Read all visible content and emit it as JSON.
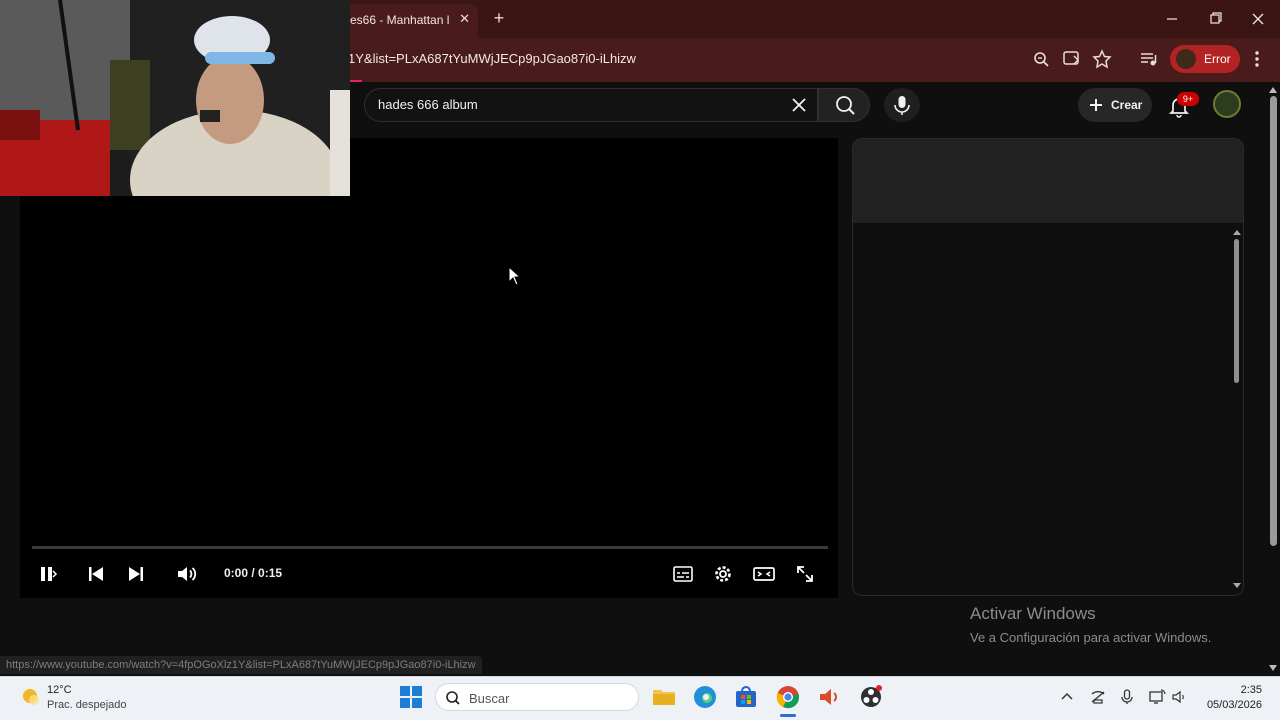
{
  "browser": {
    "tab_title": "es66 - Manhattan ll",
    "tab_close": "✕",
    "new_tab": "+",
    "url": "1Y&list=PLxA687tYuMWjJECp9pJGao87i0-iLhizw",
    "profile_status": "Error"
  },
  "youtube": {
    "search_value": "hades 666 album",
    "create_label": "Crear",
    "notification_badge": "9+"
  },
  "player": {
    "time": "0:00 / 0:15",
    "progress": 0
  },
  "watermark": {
    "line1": "Activar Windows",
    "line2": "Ve a Configuración para activar Windows."
  },
  "status_bar_url": "https://www.youtube.com/watch?v=4fpOGoXlz1Y&list=PLxA687tYuMWjJECp9pJGao87i0-iLhizw",
  "taskbar": {
    "weather_temp": "12°C",
    "weather_desc": "Prac. despejado",
    "search_placeholder": "Buscar",
    "time": "2:35",
    "date": "05/03/2026"
  },
  "colors": {
    "chrome_frame": "#3b1414",
    "error_pill": "#b42323",
    "badge_red": "#cc0000",
    "taskbar": "#eef1f6"
  }
}
